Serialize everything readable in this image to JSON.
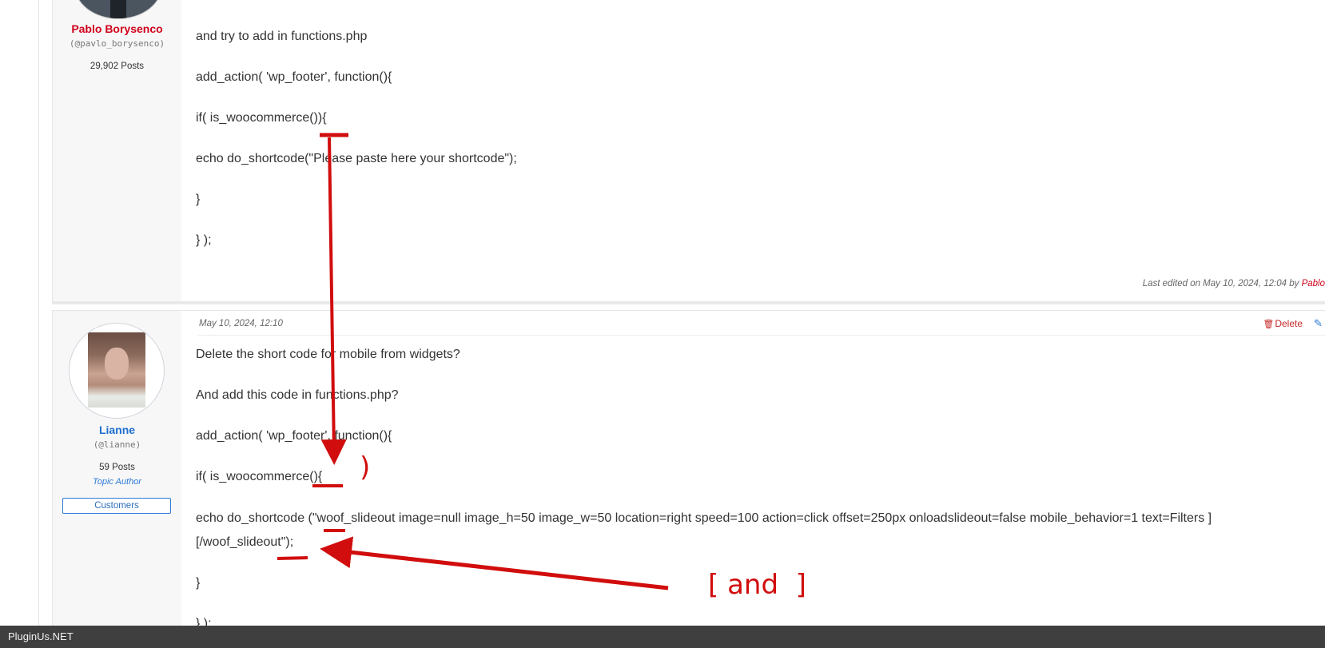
{
  "post1": {
    "author": {
      "name": "Pablo Borysenco",
      "handle": "(@pavlo_borysenco)",
      "posts": "29,902 Posts"
    },
    "lines": [
      "and try to add in functions.php",
      "add_action( 'wp_footer', function(){",
      "if( is_woocommerce()){",
      "echo do_shortcode(\"Please  paste  here  your shortcode\");",
      "}",
      "} );"
    ],
    "last_edited": "Last edited on May 10, 2024, 12:04 by",
    "last_edited_by": "Pablo"
  },
  "post2": {
    "date": "May 10, 2024, 12:10",
    "delete_label": "Delete",
    "author": {
      "name": "Lianne",
      "handle": "(@lianne)",
      "posts": "59 Posts",
      "role": "Topic Author",
      "badge": "Customers"
    },
    "lines": [
      "Delete the short code for mobile from widgets?",
      "And add this code in functions.php?",
      "add_action( 'wp_footer', function(){",
      "if( is_woocommerce(){",
      "echo do_shortcode (\"woof_slideout image=null image_h=50 image_w=50 location=right speed=100 action=click offset=250px onloadslideout=false mobile_behavior=1 text=Filters ]",
      "[/woof_slideout\");",
      "}",
      "} );"
    ]
  },
  "annotations": {
    "paren_text": ")",
    "and_text": "[ and  ]",
    "color": "#d10d0d"
  },
  "footer": {
    "brand": "PluginUs.NET"
  },
  "colors": {
    "author_name_red": "#d0021b",
    "author_name_blue": "#1e6fd0",
    "link_blue": "#2e7bd6"
  }
}
